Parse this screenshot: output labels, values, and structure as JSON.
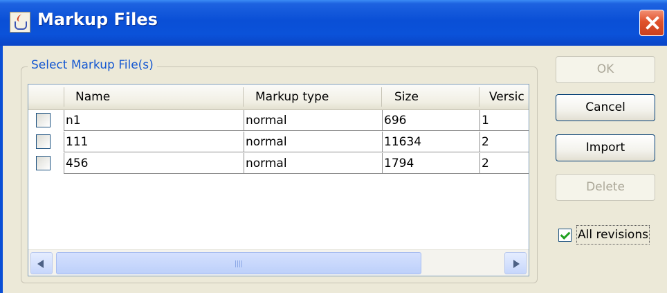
{
  "window": {
    "title": "Markup Files",
    "close_icon": "close-icon",
    "app_icon": "java-icon",
    "titlebar_color": "#0a4fd6",
    "close_color": "#e0522c"
  },
  "group": {
    "title": "Select Markup File(s)",
    "title_color": "#1558d1"
  },
  "table": {
    "columns": [
      "",
      "Name",
      "Markup type",
      "Size",
      "Versic"
    ],
    "rows": [
      {
        "checked": false,
        "name": "n1",
        "markup_type": "normal",
        "size": "696",
        "version": "1"
      },
      {
        "checked": false,
        "name": "111",
        "markup_type": "normal",
        "size": "11634",
        "version": "2"
      },
      {
        "checked": false,
        "name": "456",
        "markup_type": "normal",
        "size": "1794",
        "version": "2"
      }
    ],
    "scrollbar": {
      "left_icon": "chevron-left-icon",
      "right_icon": "chevron-right-icon"
    }
  },
  "buttons": {
    "ok": "OK",
    "cancel": "Cancel",
    "import": "Import",
    "delete": "Delete"
  },
  "all_revisions": {
    "label": "All revisions",
    "checked": true
  }
}
